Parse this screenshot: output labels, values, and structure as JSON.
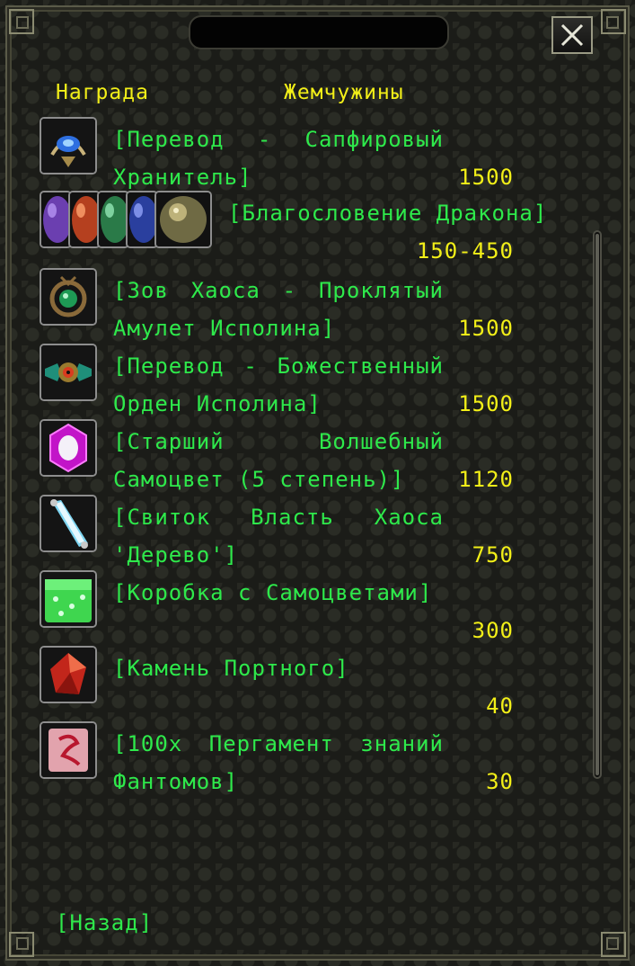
{
  "header": {
    "reward_label": "Награда",
    "pearls_label": "Жемчужины"
  },
  "close_icon": "close-icon",
  "rewards": [
    {
      "name": "[Перевод  -  Сапфировый Хранитель]",
      "price": "1500",
      "icon": "sapphire-guardian-icon"
    },
    {
      "name": "[Благословение Дракона]",
      "price": "150-450",
      "icon": "dragon-blessing-orbs-icon"
    },
    {
      "name": "[Зов Хаоса -  Проклятый Амулет   Исполина]",
      "price": "1500",
      "icon": "cursed-amulet-icon"
    },
    {
      "name": "[Перевод - Божественный Орден    Исполина]",
      "price": "1500",
      "icon": "divine-order-icon"
    },
    {
      "name": "[Старший     Волшебный Самоцвет (5 степень)]",
      "price": "1120",
      "icon": "magic-gem-icon"
    },
    {
      "name": "[Свиток  Власть   Хаоса 'Дерево']",
      "price": "750",
      "icon": "chaos-scroll-icon"
    },
    {
      "name": "[Коробка с Самоцветами]",
      "price": "300",
      "icon": "gem-box-icon"
    },
    {
      "name": "[Камень       Портного]",
      "price": "40",
      "icon": "tailor-stone-icon"
    },
    {
      "name": "[100х Пергамент  знаний Фантомов]",
      "price": "30",
      "icon": "phantom-parchment-icon"
    }
  ],
  "footer": {
    "back_label": "[Назад]"
  }
}
